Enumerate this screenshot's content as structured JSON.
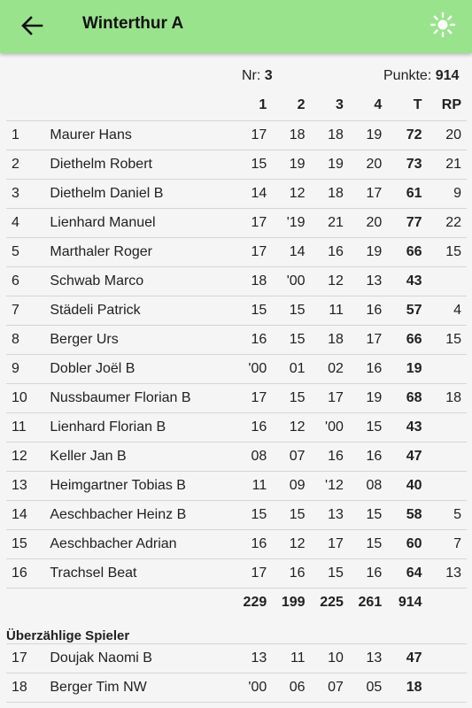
{
  "header": {
    "title": "Winterthur A",
    "back_icon": "arrow-left-icon",
    "theme_icon": "sun-icon"
  },
  "info": {
    "nr_label": "Nr:",
    "nr_value": "3",
    "points_label": "Punkte:",
    "points_value": "914"
  },
  "columns": [
    "1",
    "2",
    "3",
    "4",
    "T",
    "RP"
  ],
  "players": [
    {
      "nr": "1",
      "name": "Maurer Hans",
      "r1": "17",
      "r2": "18",
      "r3": "18",
      "r4": "19",
      "t": "72",
      "rp": "20"
    },
    {
      "nr": "2",
      "name": "Diethelm Robert",
      "r1": "15",
      "r2": "19",
      "r3": "19",
      "r4": "20",
      "t": "73",
      "rp": "21"
    },
    {
      "nr": "3",
      "name": "Diethelm Daniel B",
      "r1": "14",
      "r2": "12",
      "r3": "18",
      "r4": "17",
      "t": "61",
      "rp": "9"
    },
    {
      "nr": "4",
      "name": "Lienhard Manuel",
      "r1": "17",
      "r2": "'19",
      "r3": "21",
      "r4": "20",
      "t": "77",
      "rp": "22"
    },
    {
      "nr": "5",
      "name": "Marthaler Roger",
      "r1": "17",
      "r2": "14",
      "r3": "16",
      "r4": "19",
      "t": "66",
      "rp": "15"
    },
    {
      "nr": "6",
      "name": "Schwab Marco",
      "r1": "18",
      "r2": "'00",
      "r3": "12",
      "r4": "13",
      "t": "43",
      "rp": ""
    },
    {
      "nr": "7",
      "name": "Städeli Patrick",
      "r1": "15",
      "r2": "15",
      "r3": "11",
      "r4": "16",
      "t": "57",
      "rp": "4"
    },
    {
      "nr": "8",
      "name": "Berger Urs",
      "r1": "16",
      "r2": "15",
      "r3": "18",
      "r4": "17",
      "t": "66",
      "rp": "15"
    },
    {
      "nr": "9",
      "name": "Dobler Joël B",
      "r1": "'00",
      "r2": "01",
      "r3": "02",
      "r4": "16",
      "t": "19",
      "rp": ""
    },
    {
      "nr": "10",
      "name": "Nussbaumer Florian B",
      "r1": "17",
      "r2": "15",
      "r3": "17",
      "r4": "19",
      "t": "68",
      "rp": "18"
    },
    {
      "nr": "11",
      "name": "Lienhard Florian B",
      "r1": "16",
      "r2": "12",
      "r3": "'00",
      "r4": "15",
      "t": "43",
      "rp": ""
    },
    {
      "nr": "12",
      "name": "Keller Jan B",
      "r1": "08",
      "r2": "07",
      "r3": "16",
      "r4": "16",
      "t": "47",
      "rp": ""
    },
    {
      "nr": "13",
      "name": "Heimgartner Tobias B",
      "r1": "11",
      "r2": "09",
      "r3": "'12",
      "r4": "08",
      "t": "40",
      "rp": ""
    },
    {
      "nr": "14",
      "name": "Aeschbacher Heinz B",
      "r1": "15",
      "r2": "15",
      "r3": "13",
      "r4": "15",
      "t": "58",
      "rp": "5"
    },
    {
      "nr": "15",
      "name": "Aeschbacher Adrian",
      "r1": "16",
      "r2": "12",
      "r3": "17",
      "r4": "15",
      "t": "60",
      "rp": "7"
    },
    {
      "nr": "16",
      "name": "Trachsel Beat",
      "r1": "17",
      "r2": "16",
      "r3": "15",
      "r4": "16",
      "t": "64",
      "rp": "13"
    }
  ],
  "totals": {
    "r1": "229",
    "r2": "199",
    "r3": "225",
    "r4": "261",
    "t": "914"
  },
  "extra_section_title": "Überzählige Spieler",
  "extra_players": [
    {
      "nr": "17",
      "name": "Doujak Naomi B",
      "r1": "13",
      "r2": "11",
      "r3": "10",
      "r4": "13",
      "t": "47",
      "rp": ""
    },
    {
      "nr": "18",
      "name": "Berger Tim NW",
      "r1": "'00",
      "r2": "06",
      "r3": "07",
      "r4": "05",
      "t": "18",
      "rp": ""
    }
  ]
}
